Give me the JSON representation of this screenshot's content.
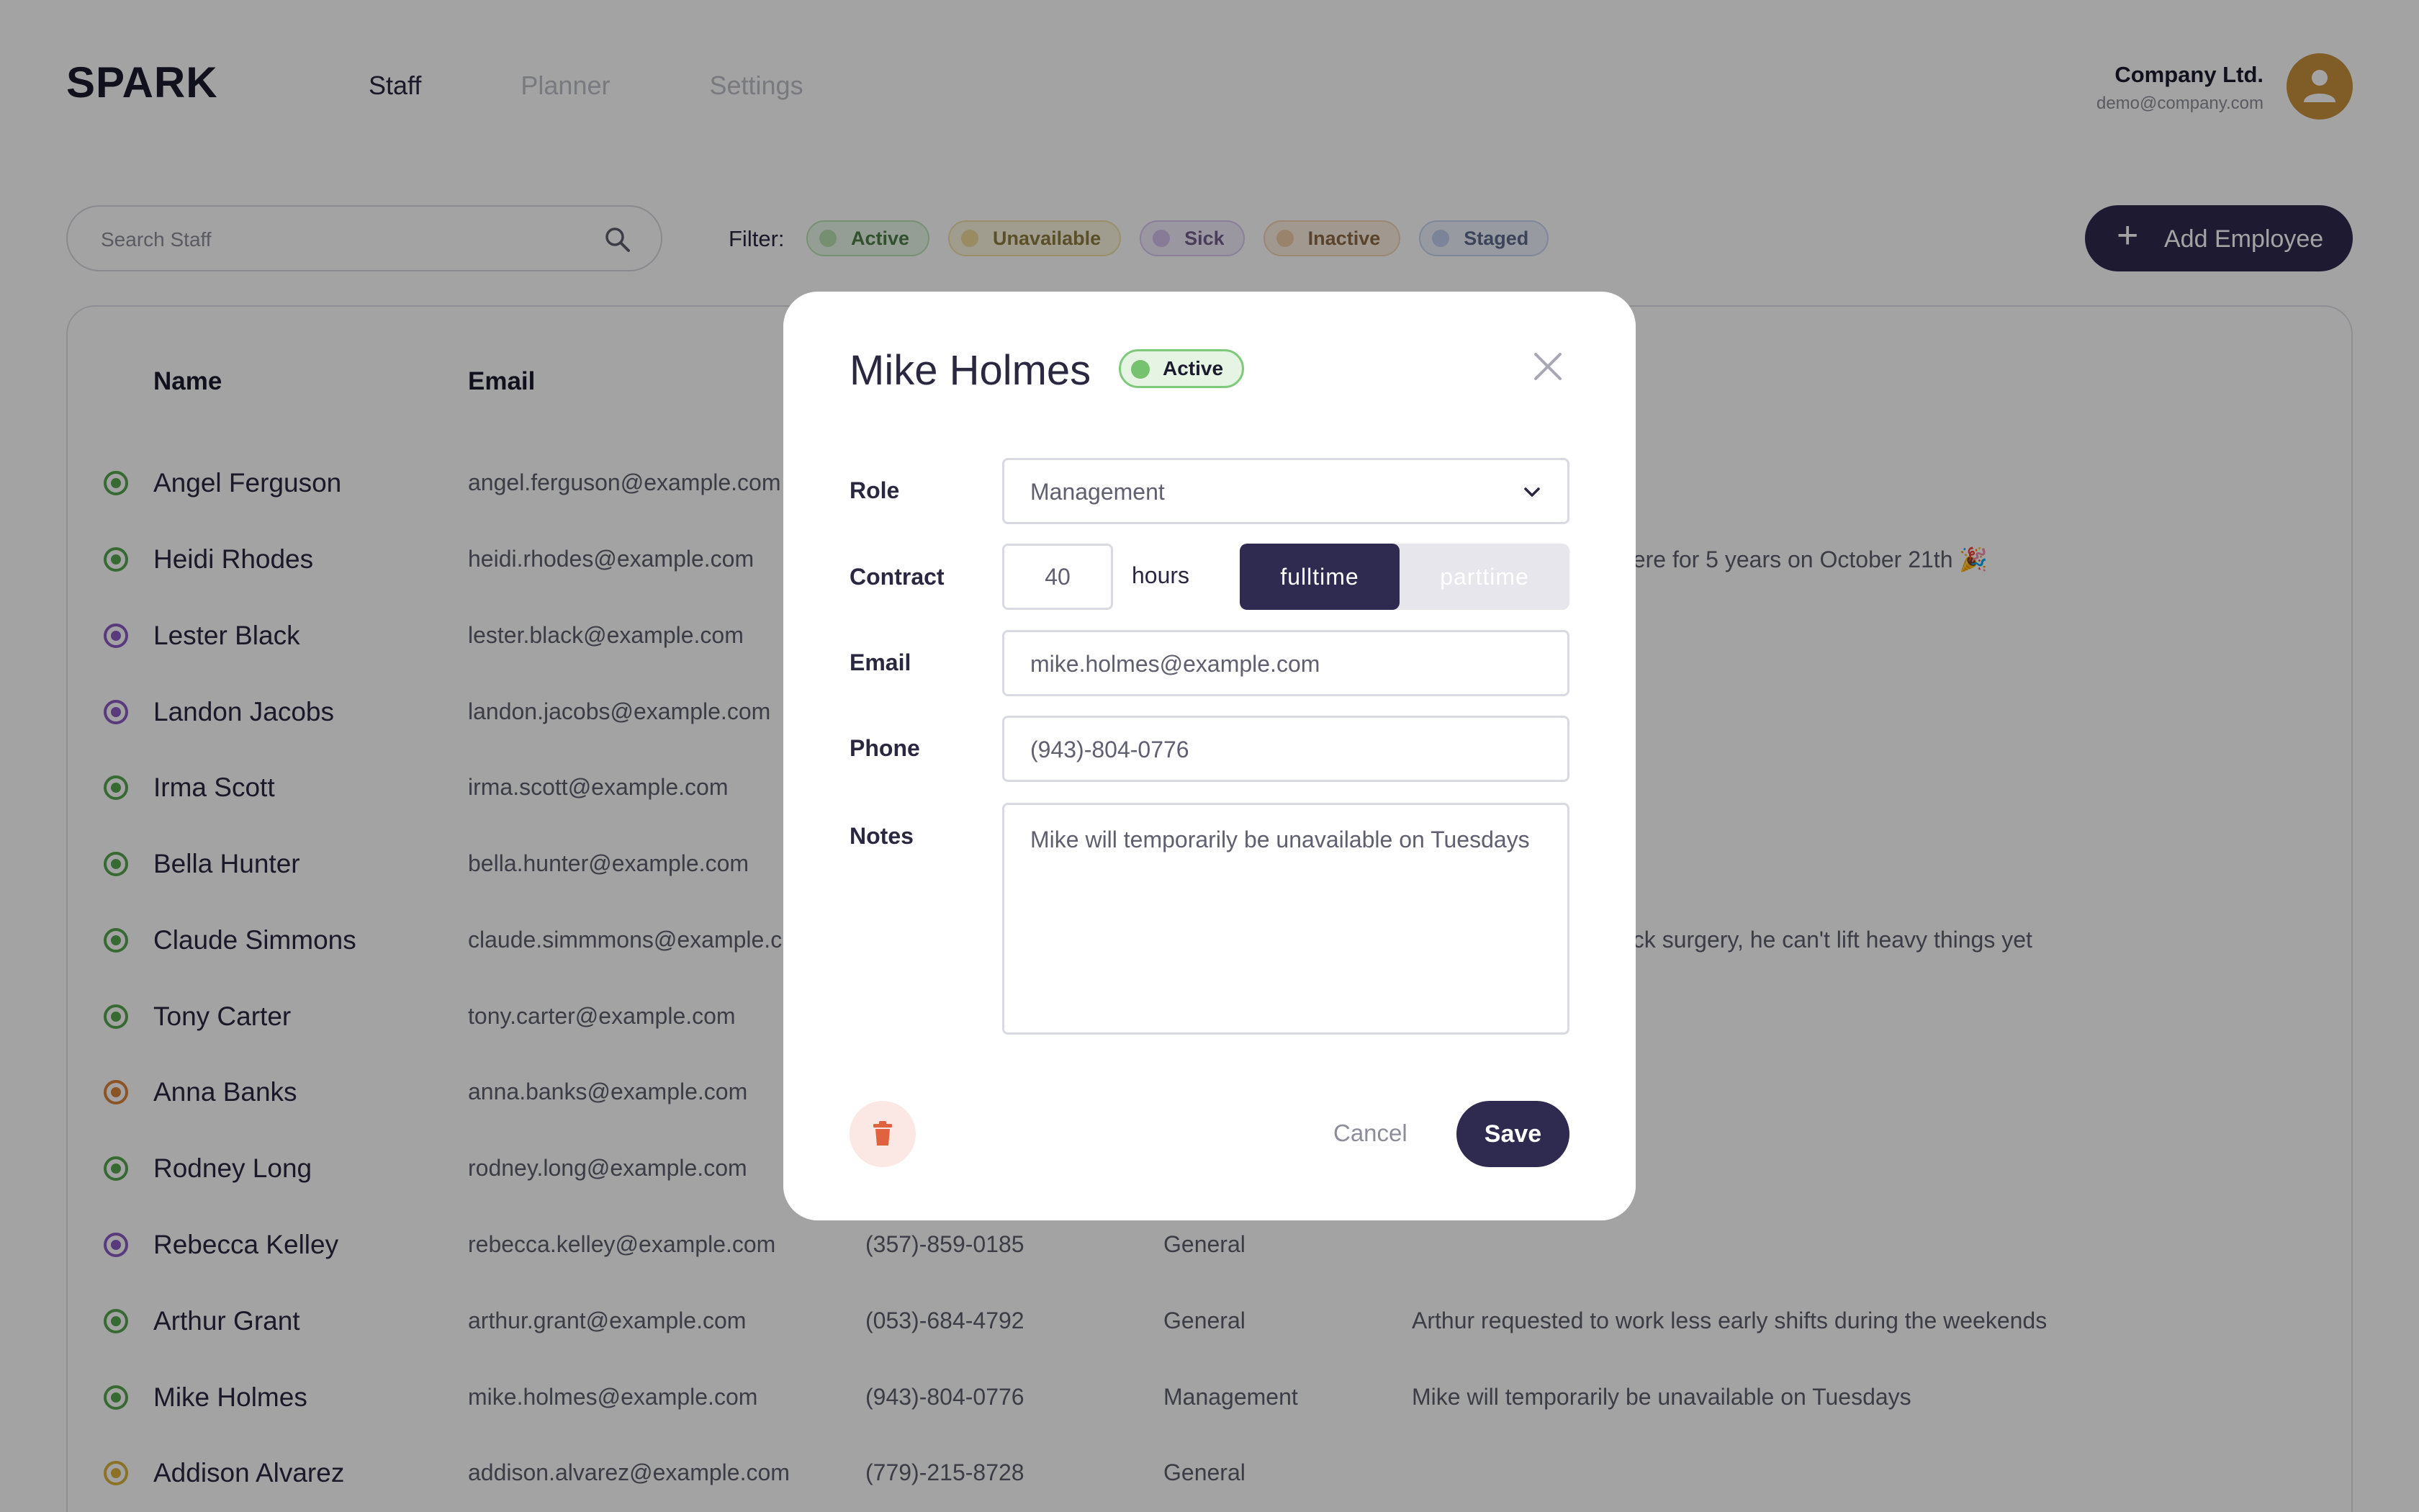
{
  "header": {
    "logo": "SPARK",
    "nav": [
      {
        "label": "Staff",
        "active": true
      },
      {
        "label": "Planner",
        "active": false
      },
      {
        "label": "Settings",
        "active": false
      }
    ],
    "account": {
      "company": "Company Ltd.",
      "email": "demo@company.com",
      "avatar_icon": "user-icon"
    }
  },
  "toolbar": {
    "search_placeholder": "Search Staff",
    "filter_label": "Filter:",
    "filters": [
      {
        "label": "Active",
        "color": "#7ec97c"
      },
      {
        "label": "Unavailable",
        "color": "#e8c86a"
      },
      {
        "label": "Sick",
        "color": "#b08ad8"
      },
      {
        "label": "Inactive",
        "color": "#e6a86a"
      },
      {
        "label": "Staged",
        "color": "#8fa7e6"
      }
    ],
    "add_button": "Add Employee"
  },
  "table": {
    "headers": {
      "name": "Name",
      "email": "Email"
    },
    "rows": [
      {
        "name": "Angel Ferguson",
        "email": "angel.ferguson@example.com",
        "phone": "",
        "role": "",
        "notes": "",
        "status_color": "#57a651"
      },
      {
        "name": "Heidi Rhodes",
        "email": "heidi.rhodes@example.com",
        "phone": "",
        "role": "",
        "notes": "here for 5 years on October 21th 🎉",
        "status_color": "#57a651"
      },
      {
        "name": "Lester Black",
        "email": "lester.black@example.com",
        "phone": "",
        "role": "",
        "notes": "",
        "status_color": "#8a5cc4"
      },
      {
        "name": "Landon Jacobs",
        "email": "landon.jacobs@example.com",
        "phone": "",
        "role": "",
        "notes": "",
        "status_color": "#8a5cc4"
      },
      {
        "name": "Irma Scott",
        "email": "irma.scott@example.com",
        "phone": "",
        "role": "",
        "notes": "",
        "status_color": "#57a651"
      },
      {
        "name": "Bella Hunter",
        "email": "bella.hunter@example.com",
        "phone": "",
        "role": "",
        "notes": "",
        "status_color": "#57a651"
      },
      {
        "name": "Claude Simmons",
        "email": "claude.simmmons@example.c",
        "phone": "",
        "role": "",
        "notes": "ack surgery, he can't lift heavy things yet",
        "status_color": "#57a651"
      },
      {
        "name": "Tony Carter",
        "email": "tony.carter@example.com",
        "phone": "",
        "role": "",
        "notes": "",
        "status_color": "#57a651"
      },
      {
        "name": "Anna Banks",
        "email": "anna.banks@example.com",
        "phone": "",
        "role": "",
        "notes": "",
        "status_color": "#d9843a"
      },
      {
        "name": "Rodney Long",
        "email": "rodney.long@example.com",
        "phone": "",
        "role": "",
        "notes": "",
        "status_color": "#57a651"
      },
      {
        "name": "Rebecca Kelley",
        "email": "rebecca.kelley@example.com",
        "phone": "(357)-859-0185",
        "role": "General",
        "notes": "",
        "status_color": "#8a5cc4"
      },
      {
        "name": "Arthur Grant",
        "email": "arthur.grant@example.com",
        "phone": "(053)-684-4792",
        "role": "General",
        "notes": "Arthur requested to work less early shifts during the weekends",
        "status_color": "#57a651"
      },
      {
        "name": "Mike Holmes",
        "email": "mike.holmes@example.com",
        "phone": "(943)-804-0776",
        "role": "Management",
        "notes": "Mike will temporarily be unavailable on Tuesdays",
        "status_color": "#57a651"
      },
      {
        "name": "Addison Alvarez",
        "email": "addison.alvarez@example.com",
        "phone": "(779)-215-8728",
        "role": "General",
        "notes": "",
        "status_color": "#d9b23a"
      }
    ]
  },
  "modal": {
    "title": "Mike Holmes",
    "status": "Active",
    "fields": {
      "role_label": "Role",
      "role_value": "Management",
      "contract_label": "Contract",
      "hours_value": "40",
      "hours_unit": "hours",
      "fulltime": "fulltime",
      "parttime": "parttime",
      "email_label": "Email",
      "email_value": "mike.holmes@example.com",
      "phone_label": "Phone",
      "phone_value": "(943)-804-0776",
      "notes_label": "Notes",
      "notes_value": "Mike will temporarily be unavailable on Tuesdays"
    },
    "actions": {
      "cancel": "Cancel",
      "save": "Save",
      "delete_icon": "trash-icon"
    }
  }
}
